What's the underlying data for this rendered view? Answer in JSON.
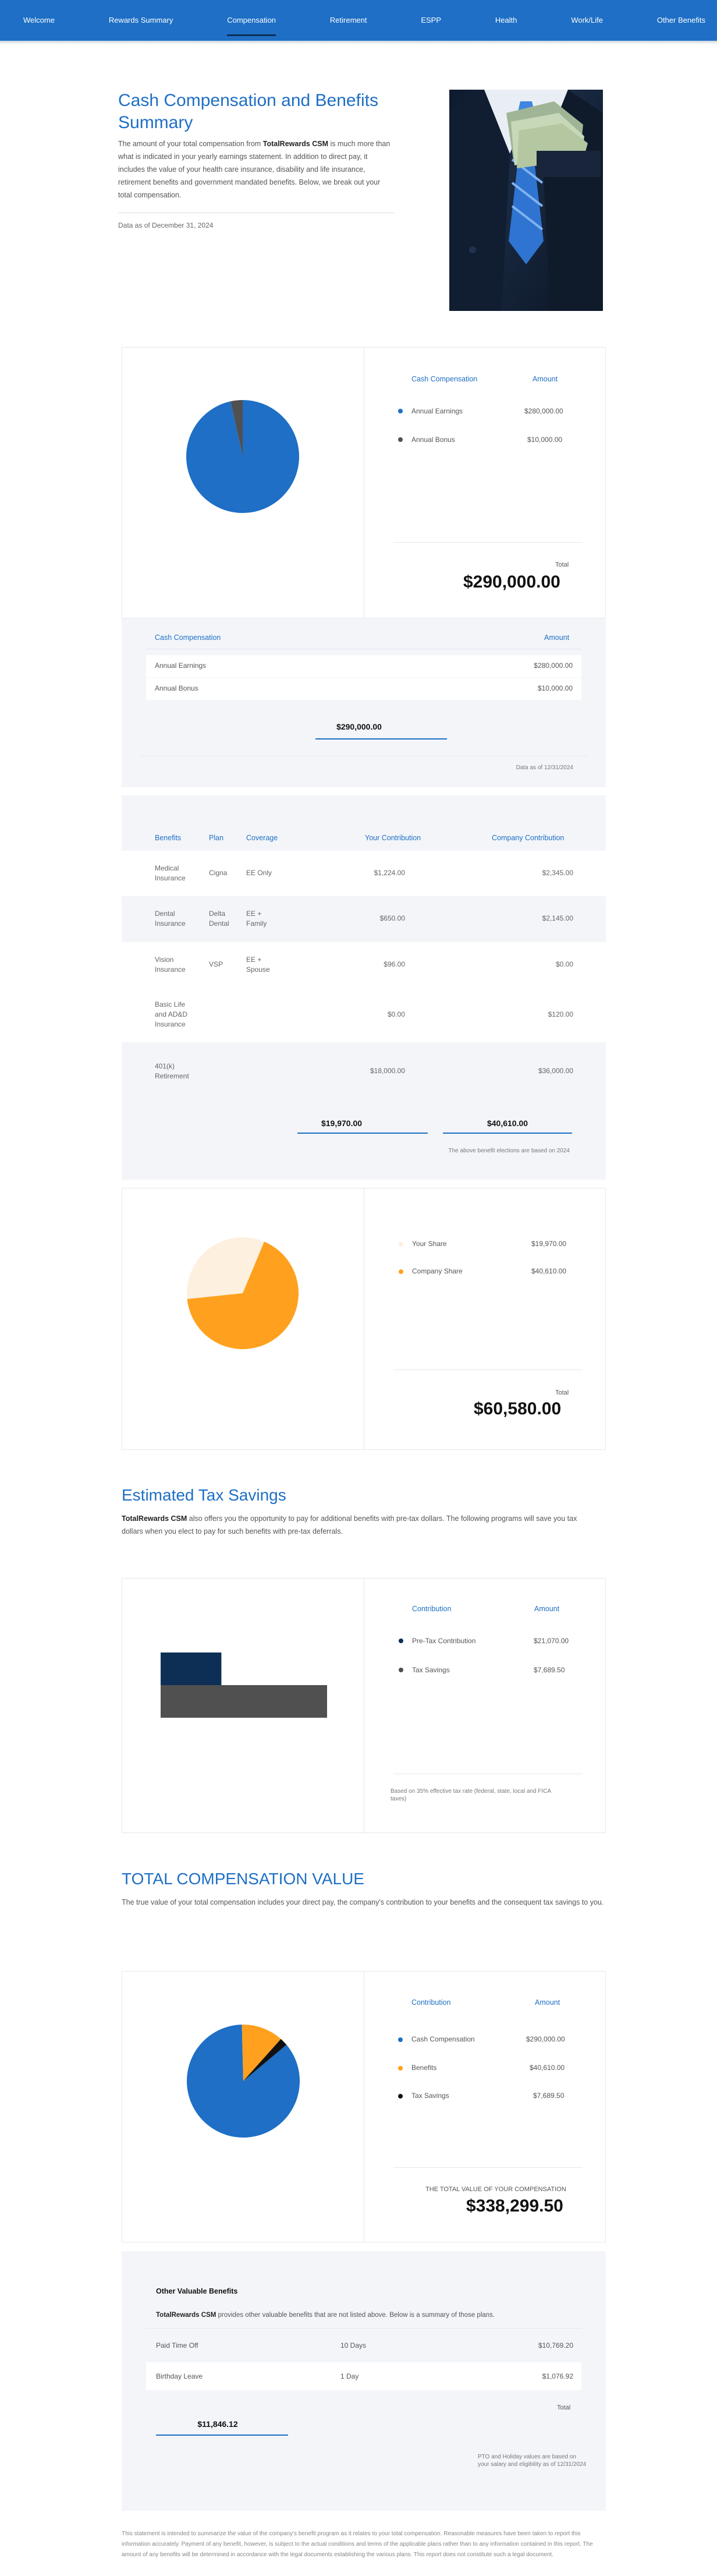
{
  "colors": {
    "primary": "#1e6fc5",
    "navy": "#0d2f55",
    "orange": "#ffa11e",
    "cream": "#fdf0df",
    "gray": "#505050",
    "dark": "#111111"
  },
  "nav": {
    "items": [
      "Welcome",
      "Rewards Summary",
      "Compensation",
      "Retirement",
      "ESPP",
      "Health",
      "Work/Life",
      "Other Benefits"
    ],
    "active": "Compensation"
  },
  "hero": {
    "title": "Cash Compensation and Benefits Summary",
    "text_before": "The amount of your total compensation from ",
    "company": "TotalRewards CSM",
    "text_after": " is much more than what is indicated in your yearly earnings statement. In addition to direct pay, it includes the value of your health care insurance, disability and life insurance, retirement benefits and government mandated benefits. Below, we break out your total compensation.",
    "date": "Data as of December 31, 2024"
  },
  "cash": {
    "header_left": "Cash Compensation",
    "header_right": "Amount",
    "items": [
      {
        "label": "Annual Earnings",
        "amount": "$280,000.00",
        "color": "#1e6fc5"
      },
      {
        "label": "Annual Bonus",
        "amount": "$10,000.00",
        "color": "#505050"
      }
    ],
    "total_label": "Total",
    "total": "$290,000.00",
    "table_total": "$290,000.00",
    "note": "Data as of 12/31/2024",
    "chart_data": {
      "type": "pie",
      "categories": [
        "Annual Earnings",
        "Annual Bonus"
      ],
      "values": [
        280000,
        10000
      ]
    }
  },
  "benefits": {
    "headers": [
      "Benefits",
      "Plan",
      "Coverage",
      "Your Contribution",
      "Company Contribution"
    ],
    "rows": [
      [
        "Medical Insurance",
        "Cigna",
        "EE Only",
        "$1,224.00",
        "$2,345.00"
      ],
      [
        "Dental Insurance",
        "Delta Dental",
        "EE + Family",
        "$650.00",
        "$2,145.00"
      ],
      [
        "Vision Insurance",
        "VSP",
        "EE + Spouse",
        "$96.00",
        "$0.00"
      ],
      [
        "Basic Life and AD&D Insurance",
        "",
        "",
        "$0.00",
        "$120.00"
      ],
      [
        "401(k) Retirement",
        "",
        "",
        "$18,000.00",
        "$36,000.00"
      ]
    ],
    "total_yours": "$19,970.00",
    "total_company": "$40,610.00",
    "note": "The above benefit elections are based on 2024"
  },
  "share": {
    "items": [
      {
        "label": "Your Share",
        "amount": "$19,970.00",
        "color": "#fdf0df"
      },
      {
        "label": "Company Share",
        "amount": "$40,610.00",
        "color": "#ffa11e"
      }
    ],
    "total_label": "Total",
    "total": "$60,580.00",
    "chart_data": {
      "type": "pie",
      "categories": [
        "Your Share",
        "Company Share"
      ],
      "values": [
        19970,
        40610
      ]
    }
  },
  "tax": {
    "title": "Estimated Tax Savings",
    "text_company": "TotalRewards CSM",
    "text": " also offers you the opportunity to pay for additional benefits with pre-tax dollars. The following programs will save you tax dollars when you elect to pay for such benefits with pre-tax deferrals.",
    "header_left": "Contribution",
    "header_right": "Amount",
    "items": [
      {
        "label": "Pre-Tax Contribution",
        "amount": "$21,070.00",
        "color": "#0d2f55"
      },
      {
        "label": "Tax Savings",
        "amount": "$7,689.50",
        "color": "#505050"
      }
    ],
    "note": "Based on 35% effective tax rate (federal, state, local and FICA taxes)",
    "chart_data": {
      "type": "bar",
      "categories": [
        "Pre-Tax Contribution",
        "Tax Savings"
      ],
      "values": [
        21070,
        7689.5
      ]
    }
  },
  "total_comp": {
    "title": "TOTAL COMPENSATION VALUE",
    "text": "The true value of your total compensation includes your direct pay, the company's contribution to your benefits and the consequent tax savings to you.",
    "header_left": "Contribution",
    "header_right": "Amount",
    "items": [
      {
        "label": "Cash Compensation",
        "amount": "$290,000.00",
        "color": "#1e6fc5"
      },
      {
        "label": "Benefits",
        "amount": "$40,610.00",
        "color": "#ffa11e"
      },
      {
        "label": "Tax Savings",
        "amount": "$7,689.50",
        "color": "#111111"
      }
    ],
    "total_label": "THE TOTAL VALUE OF YOUR COMPENSATION",
    "total": "$338,299.50",
    "chart_data": {
      "type": "pie",
      "categories": [
        "Cash Compensation",
        "Benefits",
        "Tax Savings"
      ],
      "values": [
        290000,
        40610,
        7689.5
      ]
    }
  },
  "other": {
    "title": "Other Valuable Benefits",
    "text_company": "TotalRewards CSM",
    "text": " provides other valuable benefits that are not listed above. Below is a summary of those plans.",
    "rows": [
      [
        "Paid Time Off",
        "10 Days",
        "$10,769.20"
      ],
      [
        "Birthday Leave",
        "1 Day",
        "$1,076.92"
      ]
    ],
    "total_label": "Total",
    "total": "$11,846.12",
    "note": "PTO and Holiday values are based on your salary and eligibility as of 12/31/2024"
  },
  "footer": "This statement is intended to summarize the value of the company's benefit program as it relates to your total compensation. Reasonable measures have been taken to report this information accurately. Payment of any benefit, however, is subject to the actual conditions and terms of the applicable plans rather than to any information contained in this report. The amount of any benefits will be determined in accordance with the legal documents establishing the various plans. This report does not constitute such a legal document."
}
